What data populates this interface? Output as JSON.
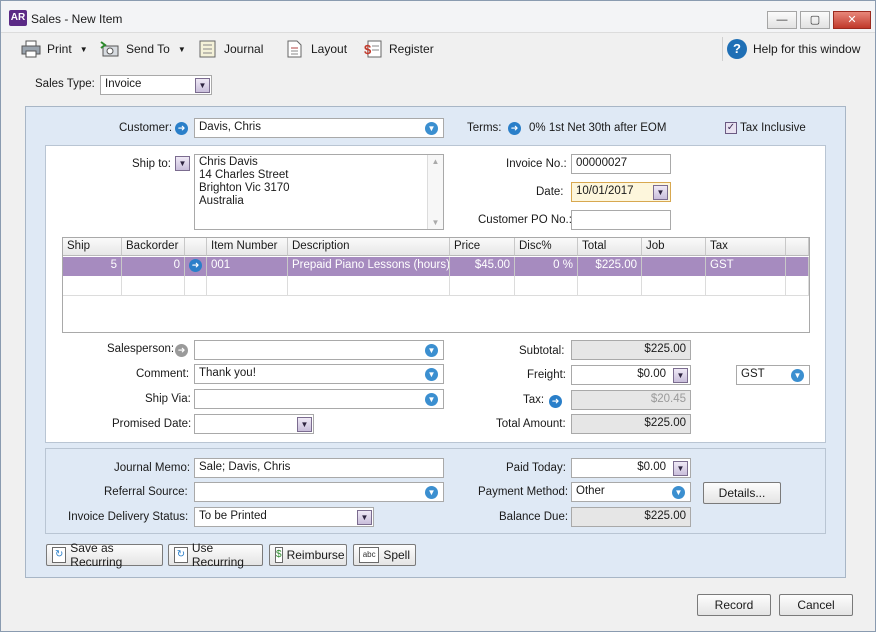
{
  "window": {
    "logo": "AR",
    "title": "Sales - New Item",
    "minimize": "—",
    "maximize": "▢",
    "close": "✕"
  },
  "toolbar": {
    "print": "Print",
    "send_to": "Send To",
    "journal": "Journal",
    "layout": "Layout",
    "register": "Register",
    "help": "Help for this window",
    "help_glyph": "?"
  },
  "sales_type": {
    "label": "Sales Type:",
    "value": "Invoice"
  },
  "header": {
    "customer_label": "Customer:",
    "customer": "Davis, Chris",
    "terms_label": "Terms:",
    "terms": "0% 1st Net 30th after EOM",
    "tax_inclusive_label": "Tax Inclusive",
    "tax_inclusive_checked": true,
    "ship_to_label": "Ship to:",
    "ship_to_lines": [
      "Chris Davis",
      "14 Charles Street",
      "Brighton  Vic  3170",
      "Australia"
    ],
    "invoice_no_label": "Invoice No.:",
    "invoice_no": "00000027",
    "date_label": "Date:",
    "date": "10/01/2017",
    "customer_po_label": "Customer PO No.:",
    "customer_po": ""
  },
  "lines": {
    "columns": [
      "Ship",
      "Backorder",
      "",
      "Item Number",
      "Description",
      "Price",
      "Disc%",
      "Total",
      "Job",
      "Tax"
    ],
    "rows": [
      {
        "ship": "5",
        "backorder": "0",
        "item_number": "001",
        "description": "Prepaid Piano Lessons (hours)",
        "price": "$45.00",
        "disc": "0 %",
        "total": "$225.00",
        "job": "",
        "tax": "GST"
      }
    ]
  },
  "details": {
    "salesperson_label": "Salesperson:",
    "salesperson": "",
    "comment_label": "Comment:",
    "comment": "Thank you!",
    "ship_via_label": "Ship Via:",
    "ship_via": "",
    "promised_date_label": "Promised Date:",
    "promised_date": ""
  },
  "totals": {
    "subtotal_label": "Subtotal:",
    "subtotal": "$225.00",
    "freight_label": "Freight:",
    "freight": "$0.00",
    "freight_tax": "GST",
    "tax_label": "Tax:",
    "tax": "$20.45",
    "total_amount_label": "Total Amount:",
    "total_amount": "$225.00"
  },
  "payment": {
    "journal_memo_label": "Journal Memo:",
    "journal_memo": "Sale; Davis, Chris",
    "referral_source_label": "Referral Source:",
    "referral_source": "",
    "delivery_status_label": "Invoice Delivery Status:",
    "delivery_status": "To be Printed",
    "paid_today_label": "Paid Today:",
    "paid_today": "$0.00",
    "payment_method_label": "Payment Method:",
    "payment_method": "Other",
    "details_button": "Details...",
    "balance_due_label": "Balance Due:",
    "balance_due": "$225.00"
  },
  "actions": {
    "save_recurring": "Save as Recurring",
    "use_recurring": "Use Recurring",
    "reimburse": "Reimburse",
    "spell": "Spell",
    "record": "Record",
    "cancel": "Cancel"
  },
  "colors": {
    "accent": "#a68bbf",
    "panel": "#dfe9f5",
    "link_arrow": "#2a7fc9"
  }
}
